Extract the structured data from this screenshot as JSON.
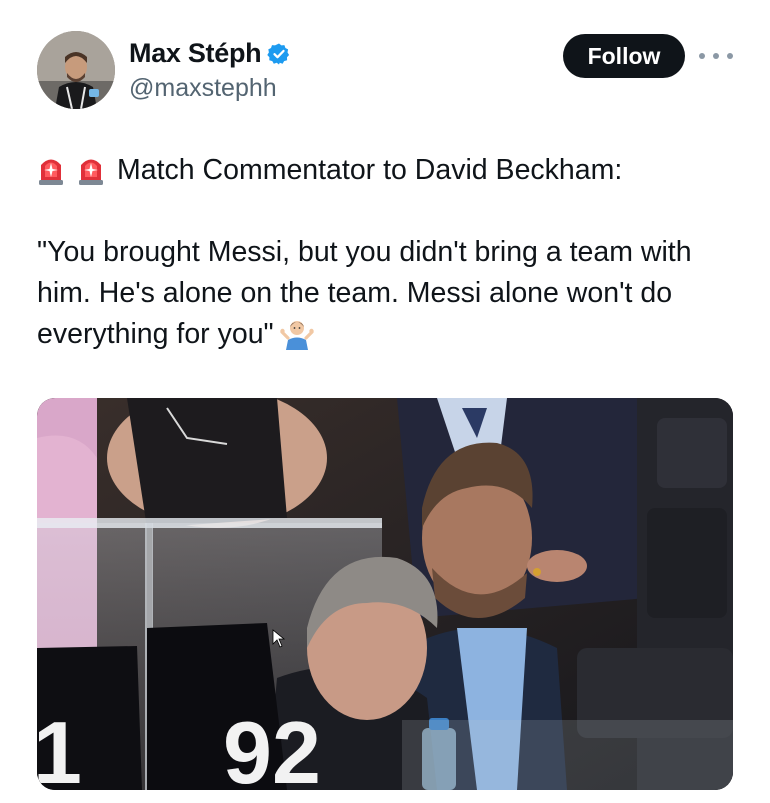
{
  "author": {
    "display_name": "Max Stéph",
    "handle": "@maxstephh",
    "verified": true,
    "avatar_icon": "avatar-photo-icon"
  },
  "actions": {
    "follow_label": "Follow",
    "more_icon": "more-options-icon"
  },
  "tweet": {
    "line1": "Match Commentator to David Beckham:",
    "line2": "\"You brought Messi, but you didn't bring a team with",
    "line3": "him. He's alone on the team. Messi alone won't do",
    "line4": "everything for you\"",
    "leading_emoji": [
      "police-light-icon",
      "police-light-icon"
    ],
    "trailing_emoji": "person-shrugging-icon"
  },
  "media": {
    "type": "photo",
    "seat_number_text": "92",
    "partial_number_text": "1"
  },
  "colors": {
    "accent_verified": "#1d9bf0",
    "follow_bg": "#0f1419",
    "text_primary": "#0f1419",
    "text_secondary": "#536471"
  }
}
